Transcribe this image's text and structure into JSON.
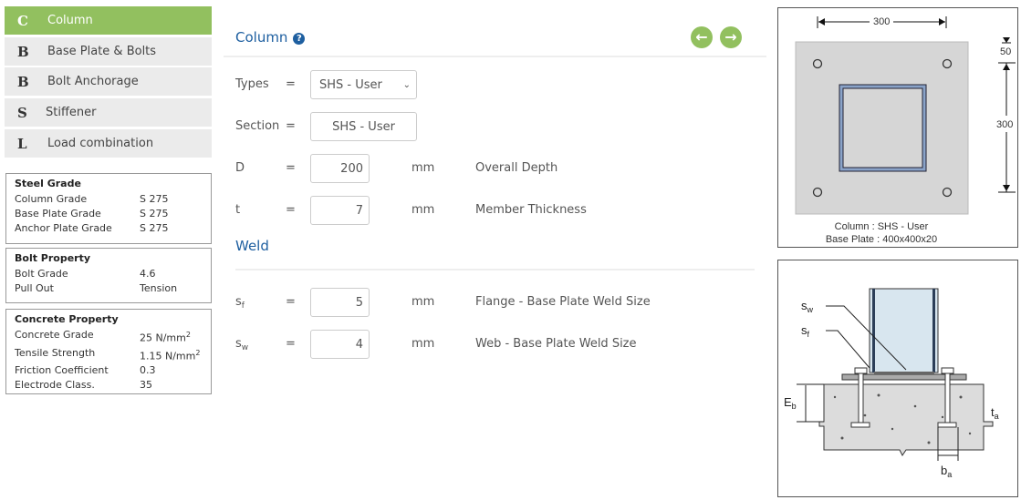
{
  "sidebar": {
    "items": [
      {
        "letter": "C",
        "label": "Column",
        "active": true
      },
      {
        "letter": "B",
        "label": "Base Plate & Bolts"
      },
      {
        "letter": "B",
        "label": "Bolt Anchorage"
      },
      {
        "letter": "S",
        "label": "Stiffener"
      },
      {
        "letter": "L",
        "label": "Load combination"
      }
    ]
  },
  "steel_grade": {
    "title": "Steel Grade",
    "rows": [
      {
        "k": "Column Grade",
        "v": "S 275"
      },
      {
        "k": "Base Plate Grade",
        "v": "S 275"
      },
      {
        "k": "Anchor Plate Grade",
        "v": "S 275"
      }
    ]
  },
  "bolt_property": {
    "title": "Bolt Property",
    "rows": [
      {
        "k": "Bolt Grade",
        "v": "4.6"
      },
      {
        "k": "Pull Out",
        "v": "Tension"
      }
    ]
  },
  "concrete_property": {
    "title": "Concrete Property",
    "rows": [
      {
        "k": "Concrete Grade",
        "v": "25 N/mm",
        "sup": "2"
      },
      {
        "k": "Tensile Strength",
        "v": "1.15 N/mm",
        "sup": "2"
      },
      {
        "k": "Friction Coefficient",
        "v": "0.3"
      },
      {
        "k": "Electrode Class.",
        "v": "35"
      }
    ]
  },
  "main": {
    "title": "Column",
    "help_icon": "question-circle-icon",
    "prev_icon": "arrow-left-circle-icon",
    "next_icon": "arrow-right-circle-icon",
    "types": {
      "label": "Types",
      "eq": "=",
      "value": "SHS - User"
    },
    "section": {
      "label": "Section",
      "eq": "=",
      "value": "SHS - User"
    },
    "D": {
      "label": "D",
      "eq": "=",
      "value": "200",
      "unit": "mm",
      "desc": "Overall Depth"
    },
    "t": {
      "label": "t",
      "eq": "=",
      "value": "7",
      "unit": "mm",
      "desc": "Member Thickness"
    },
    "weld_title": "Weld",
    "sf": {
      "label": "s",
      "sub": "f",
      "eq": "=",
      "value": "5",
      "unit": "mm",
      "desc": "Flange - Base Plate Weld Size"
    },
    "sw": {
      "label": "s",
      "sub": "w",
      "eq": "=",
      "value": "4",
      "unit": "mm",
      "desc": "Web - Base Plate Weld Size"
    }
  },
  "plan": {
    "dim_top": "300",
    "dim_edge": "50",
    "dim_side": "300",
    "caption1": "Column : SHS - User",
    "caption2": "Base Plate : 400x400x20"
  },
  "elevation": {
    "sw": "s",
    "sw_sub": "w",
    "sf": "s",
    "sf_sub": "f",
    "eb": "E",
    "eb_sub": "b",
    "ta": "t",
    "ta_sub": "a",
    "ba": "b",
    "ba_sub": "a"
  },
  "colors": {
    "accent": "#92c05f",
    "title": "#1e5fa0"
  }
}
